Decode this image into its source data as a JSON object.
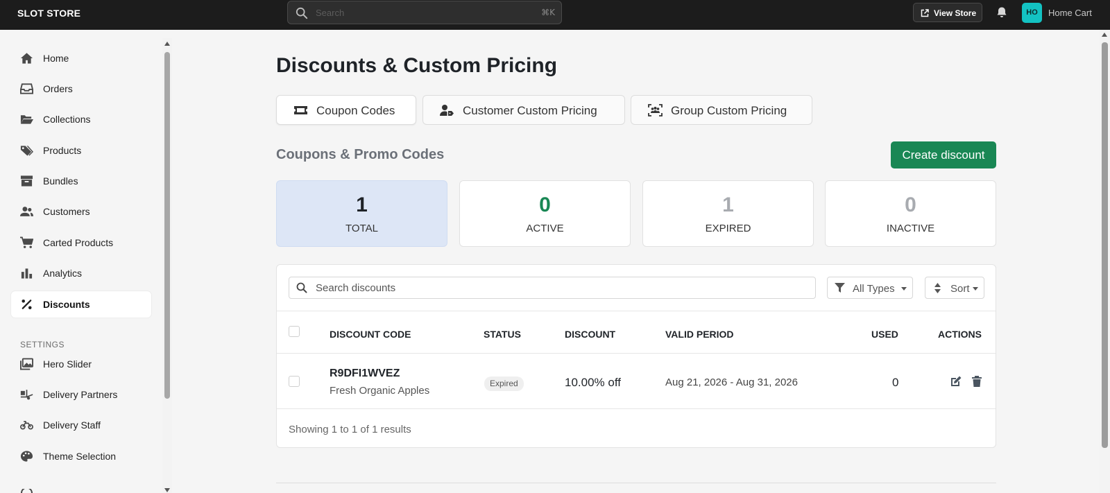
{
  "topbar": {
    "brand": "SLOT STORE",
    "search_placeholder": "Search",
    "search_shortcut": "⌘K",
    "view_store_label": "View Store",
    "avatar_initials": "HO",
    "store_name": "Home Cart"
  },
  "sidebar": {
    "items": [
      {
        "label": "Home",
        "icon": "home-icon"
      },
      {
        "label": "Orders",
        "icon": "inbox-icon"
      },
      {
        "label": "Collections",
        "icon": "folder-open-icon"
      },
      {
        "label": "Products",
        "icon": "tags-icon"
      },
      {
        "label": "Bundles",
        "icon": "archive-box-icon"
      },
      {
        "label": "Customers",
        "icon": "users-icon"
      },
      {
        "label": "Carted Products",
        "icon": "cart-icon"
      },
      {
        "label": "Analytics",
        "icon": "bar-chart-icon"
      },
      {
        "label": "Discounts",
        "icon": "percent-icon",
        "active": true
      }
    ],
    "settings_label": "SETTINGS",
    "settings_items": [
      {
        "label": "Hero Slider",
        "icon": "images-icon"
      },
      {
        "label": "Delivery Partners",
        "icon": "truck-loading-icon"
      },
      {
        "label": "Delivery Staff",
        "icon": "motorcycle-icon"
      },
      {
        "label": "Theme Selection",
        "icon": "palette-icon"
      }
    ]
  },
  "page": {
    "title": "Discounts & Custom Pricing",
    "tabs": [
      {
        "label": "Coupon Codes",
        "icon": "ticket-icon",
        "active": true
      },
      {
        "label": "Customer Custom Pricing",
        "icon": "user-tag-icon"
      },
      {
        "label": "Group Custom Pricing",
        "icon": "group-scan-icon"
      }
    ],
    "section_title": "Coupons & Promo Codes",
    "create_button": "Create discount"
  },
  "stats": [
    {
      "value": "1",
      "label": "TOTAL",
      "color": "#1f2328"
    },
    {
      "value": "0",
      "label": "ACTIVE",
      "color": "#198754"
    },
    {
      "value": "1",
      "label": "EXPIRED",
      "color": "#a8abb0"
    },
    {
      "value": "0",
      "label": "INACTIVE",
      "color": "#a8abb0"
    }
  ],
  "table": {
    "search_placeholder": "Search discounts",
    "type_filter": "All Types",
    "sort_label": "Sort",
    "headers": {
      "code": "DISCOUNT CODE",
      "status": "STATUS",
      "discount": "DISCOUNT",
      "period": "VALID PERIOD",
      "used": "USED",
      "actions": "ACTIONS"
    },
    "rows": [
      {
        "code": "R9DFI1WVEZ",
        "product": "Fresh Organic Apples",
        "status": "Expired",
        "discount": "10.00% off",
        "period": "Aug 21, 2026 - Aug 31, 2026",
        "used": "0"
      }
    ],
    "showing": "Showing 1 to 1 of 1 results"
  },
  "colors": {
    "accent_green": "#198754",
    "topbar": "#1c1c1c",
    "avatar": "#13c2c2",
    "total_card": "#dde6f6"
  }
}
